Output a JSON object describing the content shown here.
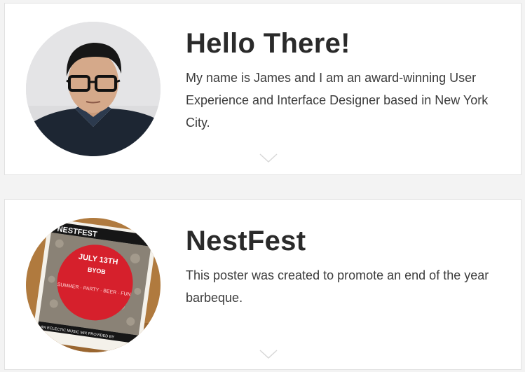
{
  "cards": [
    {
      "title": "Hello There!",
      "description": "My name is James and I am an award-winning User Experience and Interface Designer based in New York City.",
      "image": "portrait-photo",
      "expand_icon": "chevron-down-icon"
    },
    {
      "title": "NestFest",
      "description": "This poster was created to promote an end of the year barbeque.",
      "image": "poster-photo",
      "poster": {
        "brand": "NESTFEST",
        "date": "JULY 13TH",
        "extra": "BYOB",
        "tagline": "SUMMER · PARTY · BEER · FUN",
        "footer": "AN ECLECTIC MUSIC MIX PROVIDED BY"
      },
      "expand_icon": "chevron-down-icon"
    }
  ],
  "colors": {
    "background": "#f3f3f3",
    "card": "#ffffff",
    "title": "#2a2a2a",
    "text": "#3c3c3c",
    "poster_red": "#d6202c"
  }
}
